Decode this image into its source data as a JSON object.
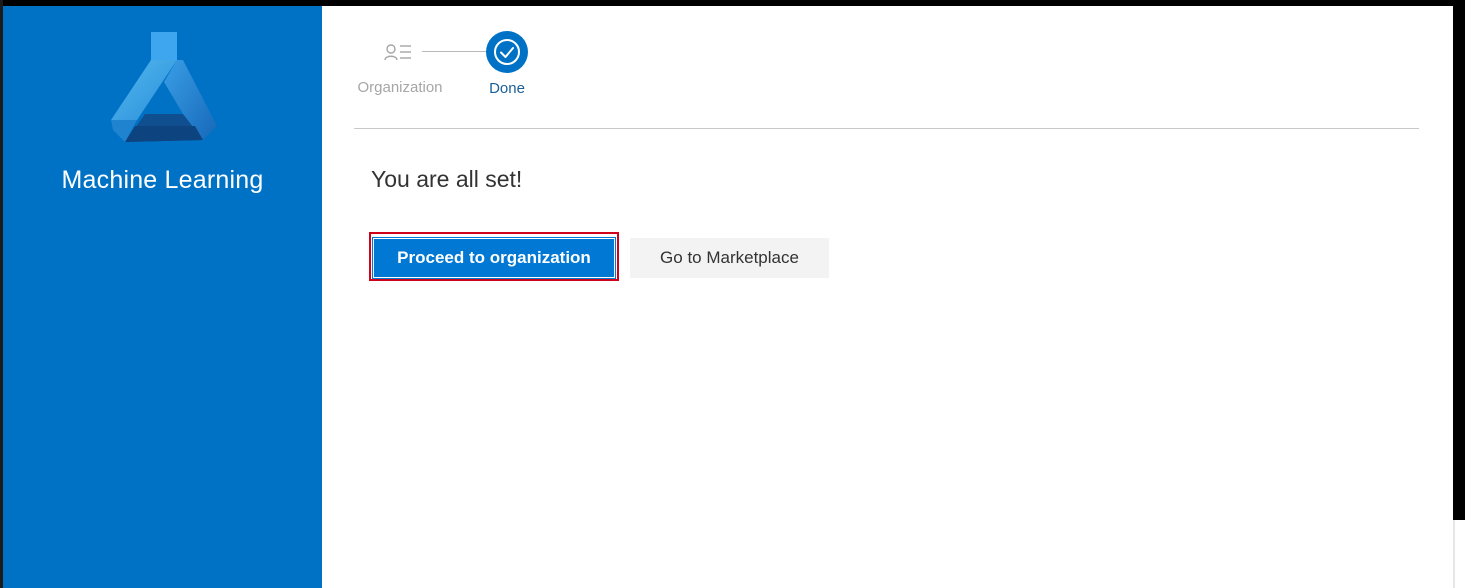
{
  "sidebar": {
    "app_name": "Machine Learning",
    "logo_icon": "flask-icon",
    "background_color": "#0072c6"
  },
  "stepper": {
    "steps": [
      {
        "label": "Organization",
        "icon": "person-list-icon",
        "state": "inactive"
      },
      {
        "label": "Done",
        "icon": "checkmark-circle-icon",
        "state": "active"
      }
    ]
  },
  "main": {
    "heading": "You are all set!",
    "primary_button": "Proceed to organization",
    "secondary_button": "Go to Marketplace"
  },
  "colors": {
    "accent": "#0078d4",
    "focus_outline": "#d0021b",
    "secondary_button_bg": "#f3f3f3"
  }
}
